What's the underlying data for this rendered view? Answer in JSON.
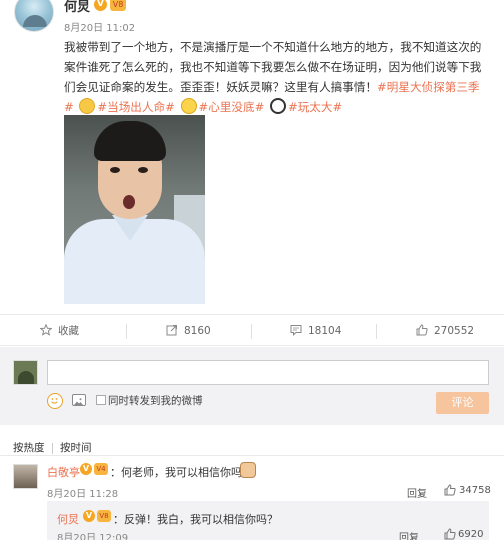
{
  "post": {
    "author": "何炅",
    "verified_badge": "V",
    "level_badge": "V8",
    "time": "8月20日 11:02",
    "text_plain": "我被带到了一个地方，不是演播厅是一个不知道什么地方的地方，我不知道这次的案件谁死了怎么死的，我也不知道等下我要怎么做不在场证明，因为他们说等下我们会见证命案的发生。歪歪歪！妖妖灵嘛？这里有人搞事情！",
    "tag1": "#明星大侦探第三季#",
    "tag2": "#当场出人命#",
    "tag3": "#心里没底#",
    "tag4": "#玩太大#",
    "emoticons": [
      "worried-emoticon",
      "anxious-emoticon",
      "panda-emoticon"
    ]
  },
  "actions": {
    "favorite_label": "收藏",
    "forward_count": "8160",
    "comment_count": "18104",
    "like_count": "270552"
  },
  "comment_box": {
    "input_value": "",
    "input_placeholder": "",
    "repost_label": "同时转发到我的微博",
    "submit_label": "评论"
  },
  "sort": {
    "by_hot": "按热度",
    "by_time": "按时间"
  },
  "comments": [
    {
      "name": "白敬亭",
      "verified_badge": "V",
      "level_badge": "V4",
      "text": "：何老师，我可以相信你吗？",
      "time": "8月20日 11:28",
      "reply_label": "回复",
      "likes": "34758",
      "reply": {
        "name": "何炅",
        "verified_badge": "V",
        "level_badge": "V8",
        "text": "：反弹！我白，我可以相信你吗？",
        "time": "8月20日 12:09",
        "reply_label": "回复",
        "likes": "6920"
      }
    }
  ],
  "colors": {
    "link_orange": "#eb7350",
    "submit_disabled": "#f6c49d",
    "comment_area_bg": "#f2f2f5",
    "verified_gold": "#f5a623"
  }
}
